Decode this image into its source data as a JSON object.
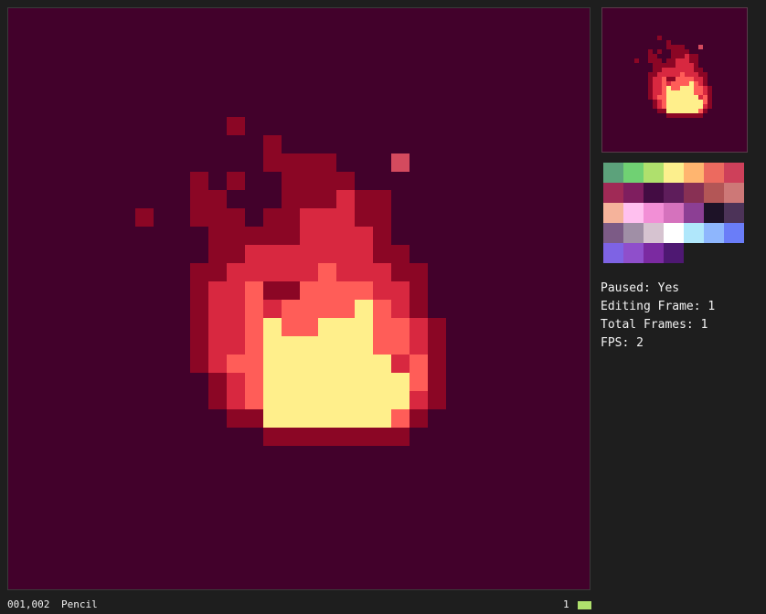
{
  "canvas_bg": "#42012b",
  "palette": [
    "#5ca27b",
    "#70d173",
    "#afe06d",
    "#fcef8d",
    "#ffb56f",
    "#ec6a5f",
    "#ce405a",
    "#a02a56",
    "#7f1e5f",
    "#430c43",
    "#5e1d5b",
    "#883054",
    "#b35656",
    "#cd7877",
    "#f5b39b",
    "#ffc0ef",
    "#f28fd6",
    "#d572bd",
    "#8c3f94",
    "#1d1227",
    "#4c3358",
    "#7c5b86",
    "#a08fa6",
    "#d6c3d0",
    "#ffffff",
    "#b0e7fb",
    "#8eb6fd",
    "#6a7df8",
    "#7e63e4",
    "#8f4fcb",
    "#7b2aa1",
    "#4e1872"
  ],
  "colors": {
    "dark_red": "#8b0625",
    "red": "#d82840",
    "orange_red": "#ff5d58",
    "yellow": "#ffef8b",
    "spark": "#d44a5e"
  },
  "sprite_rows": [
    "......k..................",
    "..........................",
    ".......dd.................",
    ".......ddd...........",
    "...d.d..ddd...........",
    "...dd...ddr.....",
    "...ddd.dddrrd...........",
    "d...ddd.ddrrrd",
    "....dddrrrrrdd",
    "....ddrrrrorrdd",
    "...ddrooroorood",
    "...dddrorooooorrd",
    "...drrooooooyrrd",
    "...drroyyyyoord",
    "...drrooyyyyoord",
    "...droyyyyyyyrod",
    "....ddoyyyyyyyyrd",
    "....droyyyyyyyordd",
    "....drooyyyyyyyor",
    ".....ddoyyyyyyyodd",
    ".......dddddd"
  ],
  "info": {
    "paused": "Paused: Yes",
    "editing_frame": "Editing Frame: 1",
    "total_frames": "Total Frames: 1",
    "fps": "FPS: 2"
  },
  "status": {
    "coords": "001,002",
    "tool": "Pencil",
    "frame": "1",
    "current_color": "#afe06d"
  }
}
